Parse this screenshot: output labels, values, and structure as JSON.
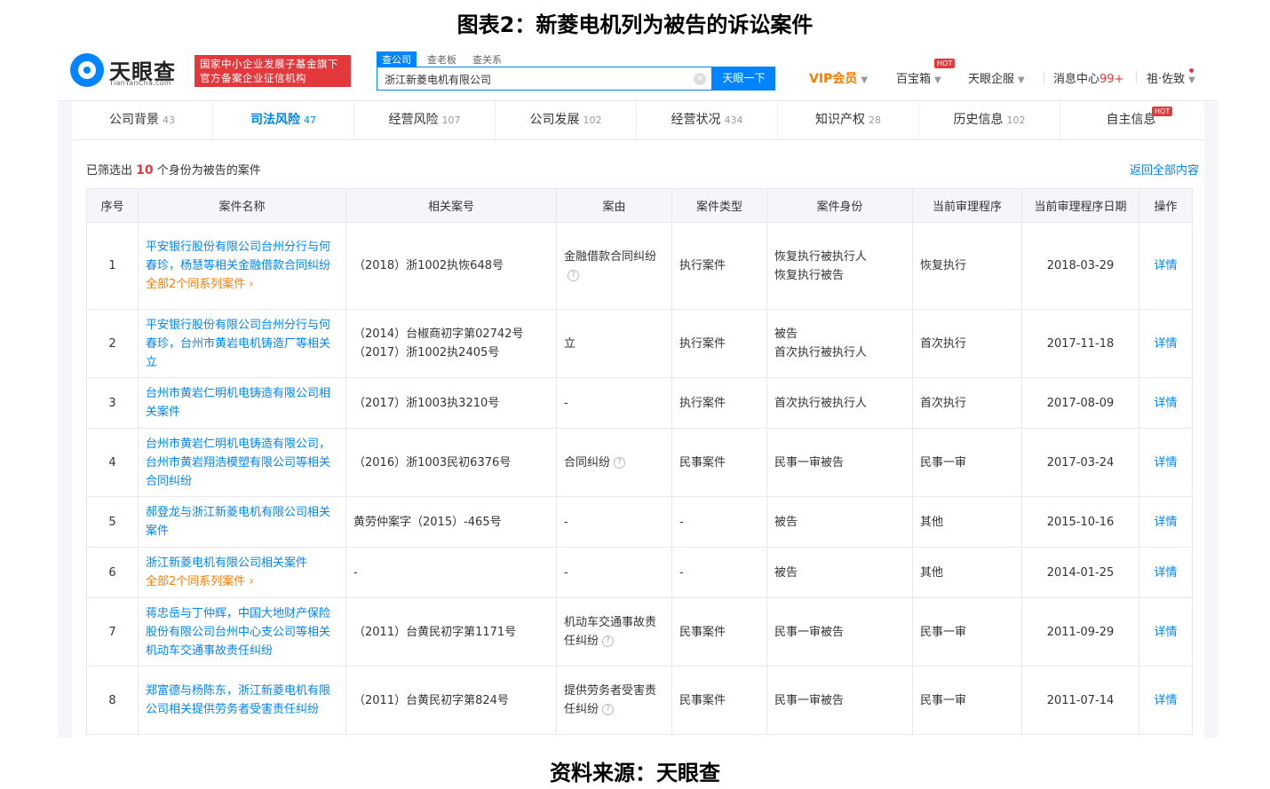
{
  "figure": {
    "title": "图表2：新菱电机列为被告的诉讼案件",
    "source": "资料来源：天眼查"
  },
  "header": {
    "logo_text": "天眼查",
    "logo_sub": "TianYanCha.com",
    "badge_line1": "国家中小企业发展子基金旗下",
    "badge_line2": "官方备案企业征信机构",
    "search_tabs": [
      "查公司",
      "查老板",
      "查关系"
    ],
    "search_value": "浙江新菱电机有限公司",
    "search_button": "天眼一下",
    "nav": {
      "vip": "VIP会员",
      "baibaoxiang": "百宝箱",
      "hot": "HOT",
      "qifu": "天眼企服",
      "messages": "消息中心",
      "messages_count": "99+",
      "user": "祖·佐致"
    }
  },
  "main_tabs": [
    {
      "label": "公司背景",
      "count": "43"
    },
    {
      "label": "司法风险",
      "count": "47"
    },
    {
      "label": "经营风险",
      "count": "107"
    },
    {
      "label": "公司发展",
      "count": "102"
    },
    {
      "label": "经营状况",
      "count": "434"
    },
    {
      "label": "知识产权",
      "count": "28"
    },
    {
      "label": "历史信息",
      "count": "102"
    },
    {
      "label": "自主信息",
      "count": ""
    }
  ],
  "filter": {
    "prefix": "已筛选出",
    "count": "10",
    "suffix": "个身份为被告的案件",
    "back": "返回全部内容"
  },
  "table": {
    "headers": [
      "序号",
      "案件名称",
      "相关案号",
      "案由",
      "案件类型",
      "案件身份",
      "当前审理程序",
      "当前审理程序日期",
      "操作"
    ],
    "rows": [
      {
        "no": "1",
        "name": "平安银行股份有限公司台州分行与何春珍，杨慧等相关金融借款合同纠纷",
        "series": "全部2个同系列案件 ›",
        "case_no": [
          "（2018）浙1002执恢648号"
        ],
        "cause": "金融借款合同纠纷",
        "cause_help": true,
        "type": "执行案件",
        "role": [
          "恢复执行被执行人",
          "恢复执行被告"
        ],
        "stage": "恢复执行",
        "date": "2018-03-29",
        "action": "详情"
      },
      {
        "no": "2",
        "name": "平安银行股份有限公司台州分行与何春珍，台州市黄岩电机铸造厂等相关立",
        "series": "",
        "case_no": [
          "（2014）台椒商初字第02742号",
          "（2017）浙1002执2405号"
        ],
        "cause": "立",
        "cause_help": false,
        "type": "执行案件",
        "role": [
          "被告",
          "首次执行被执行人"
        ],
        "stage": "首次执行",
        "date": "2017-11-18",
        "action": "详情"
      },
      {
        "no": "3",
        "name": "台州市黄岩仁明机电铸造有限公司相关案件",
        "series": "",
        "case_no": [
          "（2017）浙1003执3210号"
        ],
        "cause": "-",
        "cause_help": false,
        "type": "执行案件",
        "role": [
          "首次执行被执行人"
        ],
        "stage": "首次执行",
        "date": "2017-08-09",
        "action": "详情"
      },
      {
        "no": "4",
        "name": "台州市黄岩仁明机电铸造有限公司，台州市黄岩翔浩模塑有限公司等相关合同纠纷",
        "series": "",
        "case_no": [
          "（2016）浙1003民初6376号"
        ],
        "cause": "合同纠纷",
        "cause_help": true,
        "type": "民事案件",
        "role": [
          "民事一审被告"
        ],
        "stage": "民事一审",
        "date": "2017-03-24",
        "action": "详情"
      },
      {
        "no": "5",
        "name": "郝登龙与浙江新菱电机有限公司相关案件",
        "series": "",
        "case_no": [
          "黄劳仲案字（2015）-465号"
        ],
        "cause": "-",
        "cause_help": false,
        "type": "-",
        "role": [
          "被告"
        ],
        "stage": "其他",
        "date": "2015-10-16",
        "action": "详情"
      },
      {
        "no": "6",
        "name": "浙江新菱电机有限公司相关案件",
        "series": "全部2个同系列案件 ›",
        "case_no": [
          "-"
        ],
        "cause": "-",
        "cause_help": false,
        "type": "-",
        "role": [
          "被告"
        ],
        "stage": "其他",
        "date": "2014-01-25",
        "action": "详情"
      },
      {
        "no": "7",
        "name": "蒋忠岳与丁仲辉，中国大地财产保险股份有限公司台州中心支公司等相关机动车交通事故责任纠纷",
        "series": "",
        "case_no": [
          "（2011）台黄民初字第1171号"
        ],
        "cause": "机动车交通事故责任纠纷",
        "cause_help": true,
        "type": "民事案件",
        "role": [
          "民事一审被告"
        ],
        "stage": "民事一审",
        "date": "2011-09-29",
        "action": "详情"
      },
      {
        "no": "8",
        "name": "郑富德与杨陈东，浙江新菱电机有限公司相关提供劳务者受害责任纠纷",
        "series": "",
        "case_no": [
          "（2011）台黄民初字第824号"
        ],
        "cause": "提供劳务者受害责任纠纷",
        "cause_help": true,
        "type": "民事案件",
        "role": [
          "民事一审被告"
        ],
        "stage": "民事一审",
        "date": "2011-07-14",
        "action": "详情"
      }
    ]
  },
  "colors": {
    "accent": "#0084ff",
    "orange": "#ff7b00",
    "red": "#e4393c"
  }
}
